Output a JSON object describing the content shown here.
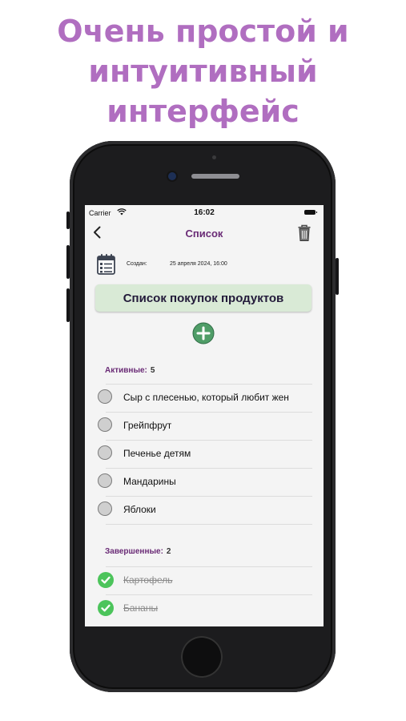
{
  "headline": [
    "Очень простой и",
    "интуитивный",
    "интерфейс"
  ],
  "status_bar": {
    "carrier": "Carrier",
    "time": "16:02"
  },
  "nav": {
    "title": "Список"
  },
  "meta": {
    "created_label": "Создан:",
    "created_date": "25 апреля 2024, 16:00"
  },
  "list_title": "Список покупок продуктов",
  "active": {
    "label": "Активные:",
    "count": "5",
    "items": [
      "Сыр с плесенью, который любит жен",
      "Грейпфрут",
      "Печенье детям",
      "Мандарины",
      "Яблоки"
    ]
  },
  "completed": {
    "label": "Завершенные:",
    "count": "2",
    "items": [
      "Картофель",
      "Бананы"
    ]
  },
  "colors": {
    "headline": "#b06ec0",
    "accent_purple": "#6a2b76",
    "title_box": "#d9ead6",
    "check_green": "#4cc45b",
    "add_button": "#4f9d67"
  },
  "icons": {
    "back": "chevron-left-icon",
    "trash": "trash-icon",
    "calendar": "calendar-list-icon",
    "add": "plus-circle-icon",
    "check": "checkmark-circle-icon"
  }
}
